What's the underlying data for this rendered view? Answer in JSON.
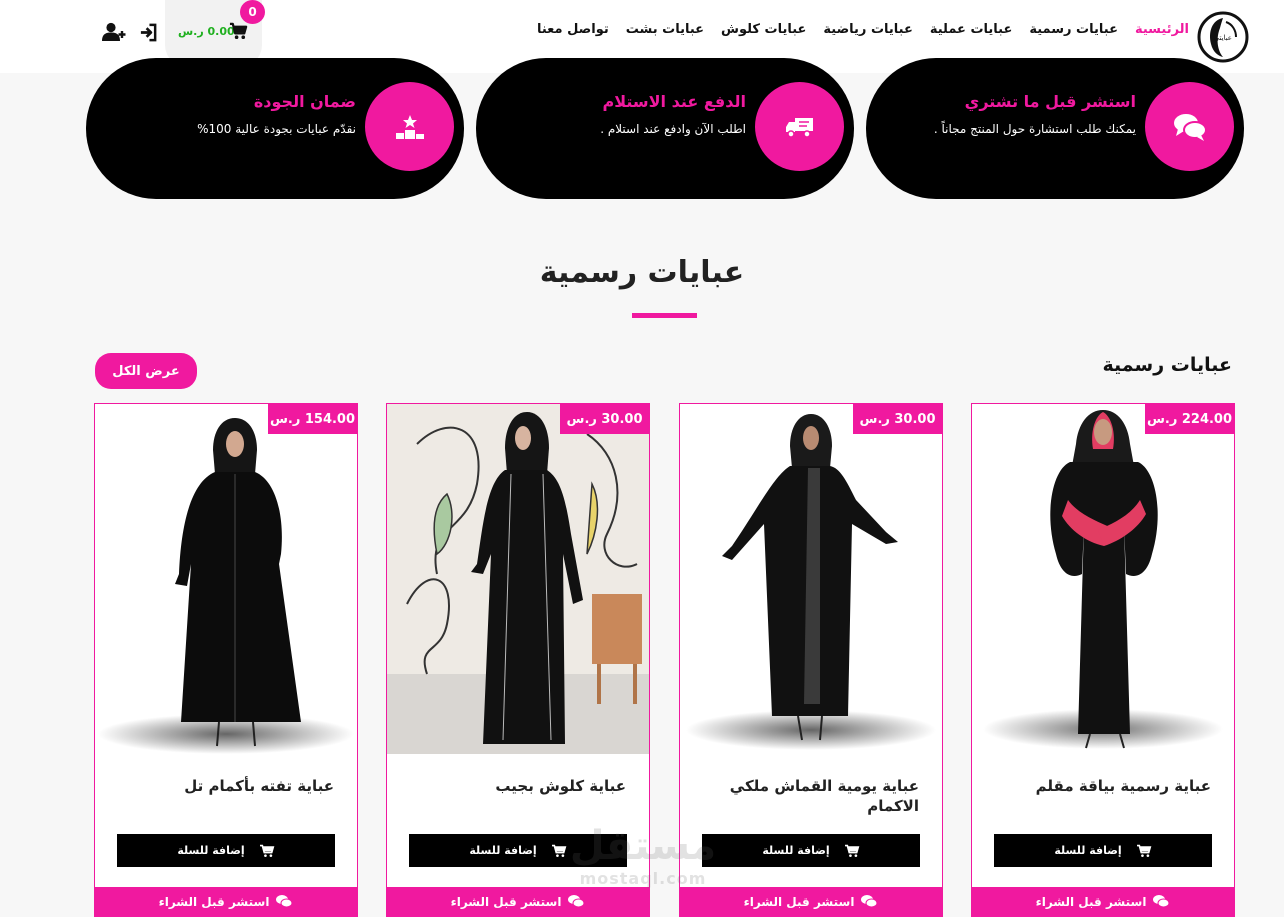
{
  "header": {
    "nav": [
      {
        "label": "الرئيسية",
        "active": true
      },
      {
        "label": "عبايات رسمية",
        "active": false
      },
      {
        "label": "عبايات عملية",
        "active": false
      },
      {
        "label": "عبايات رياضية",
        "active": false
      },
      {
        "label": "عبايات كلوش",
        "active": false
      },
      {
        "label": "عبايات بشت",
        "active": false
      },
      {
        "label": "تواصل معنا",
        "active": false
      }
    ],
    "cart_count": "0",
    "cart_total": "0.00 ر.س"
  },
  "features": [
    {
      "title": "استشر قبل ما تشتري",
      "text": "يمكنك طلب استشارة حول المنتج مجاناً .",
      "icon": "chat-bubbles-icon"
    },
    {
      "title": "الدفع عند الاستلام",
      "text": "اطلب الآن وادفع عند استلام .",
      "icon": "delivery-truck-icon"
    },
    {
      "title": "ضمان الجودة",
      "text": "نقدّم عبايات بجودة عالية 100%",
      "icon": "podium-star-icon"
    }
  ],
  "section": {
    "title": "عبايات رسمية",
    "subtitle": "عبايات رسمية",
    "view_all": "عرض الكل"
  },
  "products": [
    {
      "name": "عباية رسمية بياقة مقلم",
      "price": "224.00 ر.س",
      "add_label": "إضافة للسلة",
      "consult_label": "استشر قبل الشراء"
    },
    {
      "name": "عباية يومية القماش ملكي الاكمام",
      "price": "30.00 ر.س",
      "add_label": "إضافة للسلة",
      "consult_label": "استشر قبل الشراء"
    },
    {
      "name": "عباية كلوش بجيب",
      "price": "30.00 ر.س",
      "add_label": "إضافة للسلة",
      "consult_label": "استشر قبل الشراء"
    },
    {
      "name": "عباية تفته بأكمام تل",
      "price": "154.00 ر.س",
      "add_label": "إضافة للسلة",
      "consult_label": "استشر قبل الشراء"
    }
  ],
  "watermark": {
    "line1": "مستقل",
    "line2": "mostaql.com"
  },
  "colors": {
    "accent": "#f0199f",
    "dark": "#000000",
    "cart_total": "#20b020"
  }
}
